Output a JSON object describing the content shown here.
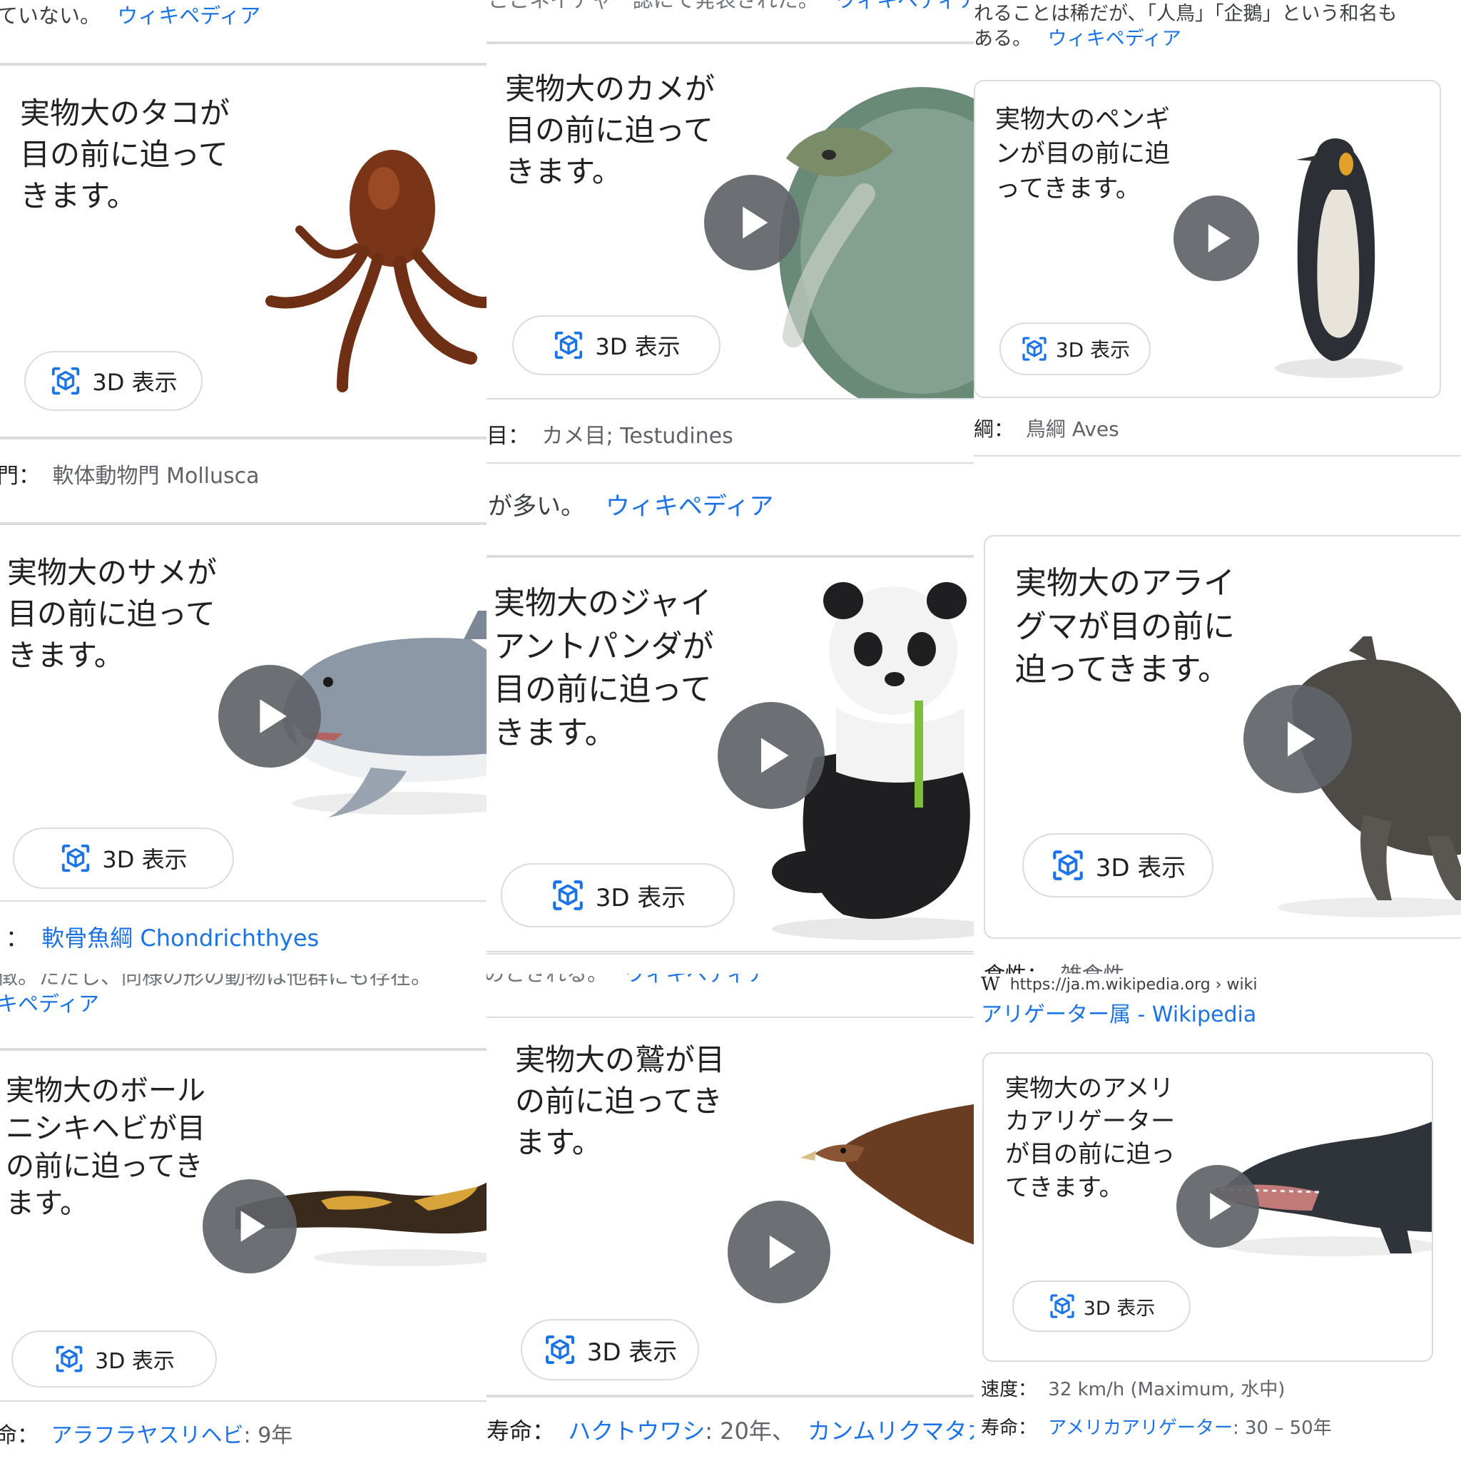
{
  "common": {
    "wiki_link": "ウィキペディア",
    "view_3d": "3D 表示"
  },
  "tiles": [
    {
      "snippet_text": "ていない。",
      "card_text": "実物大のタコが\n目の前に迫って\nきます。",
      "fact_key": "門：",
      "fact_value": "軟体動物門 Mollusca",
      "animal": "octopus"
    },
    {
      "snippet_text": "ここネイチャー誌にて発表された。",
      "card_text": "実物大のカメが\n目の前に迫って\nきます。",
      "fact_key": "目：",
      "fact_value": "カメ目; Testudines",
      "animal": "turtle"
    },
    {
      "snippet_line1": "れることは稀だが、「人鳥」「企鵝」という和名も",
      "snippet_line2": "ある。",
      "card_text": "実物大のペンギ\nンが目の前に迫\nってきます。",
      "fact_key": "綱：",
      "fact_value": "鳥綱 Aves",
      "animal": "penguin"
    },
    {
      "card_text": "実物大のサメが\n目の前に迫って\nきます。",
      "fact_key": "：",
      "fact_link": "軟骨魚綱 Chondrichthyes",
      "animal": "shark"
    },
    {
      "snippet_text": "が多い。",
      "card_text": "実物大のジャイ\nアントパンダが\n目の前に迫って\nきます。",
      "animal": "panda"
    },
    {
      "card_text": "実物大のアライ\nグマが目の前に\n迫ってきます。",
      "fact_key": "食性：",
      "fact_value": "雑食性",
      "animal": "raccoon"
    },
    {
      "snippet_text": "徴。ただし、同様の形の動物は他群にも存在。",
      "snippet_link2": "キペディア",
      "card_text": "実物大のボール\nニシキヘビが目\nの前に迫ってき\nます。",
      "fact_key": "命：",
      "fact_link": "アラフラヤスリヘビ",
      "fact_value": ": 9年",
      "animal": "python"
    },
    {
      "snippet_text": "のとされる。",
      "card_text": "実物大の鷲が目\nの前に迫ってき\nます。",
      "fact_key": "寿命：",
      "fact_link": "ハクトウワシ",
      "fact_value": ": 20年、",
      "fact_link2": "カンムリクマタカ",
      "animal": "eagle"
    },
    {
      "url": "https://ja.m.wikipedia.org › wiki",
      "wiki_logo": "W",
      "result_title": "アリゲーター属 - Wikipedia",
      "card_text": "実物大のアメリ\nカアリゲーター\nが目の前に迫っ\nてきます。",
      "fact1_key": "速度：",
      "fact1_value": "32 km/h (Maximum, 水中)",
      "fact2_key": "寿命：",
      "fact2_link": "アメリカアリゲーター",
      "fact2_value": ": 30 – 50年",
      "animal": "alligator"
    }
  ],
  "colors": {
    "link": "#1a73e8",
    "play_button": "#5f6368",
    "border": "#dadce0"
  }
}
